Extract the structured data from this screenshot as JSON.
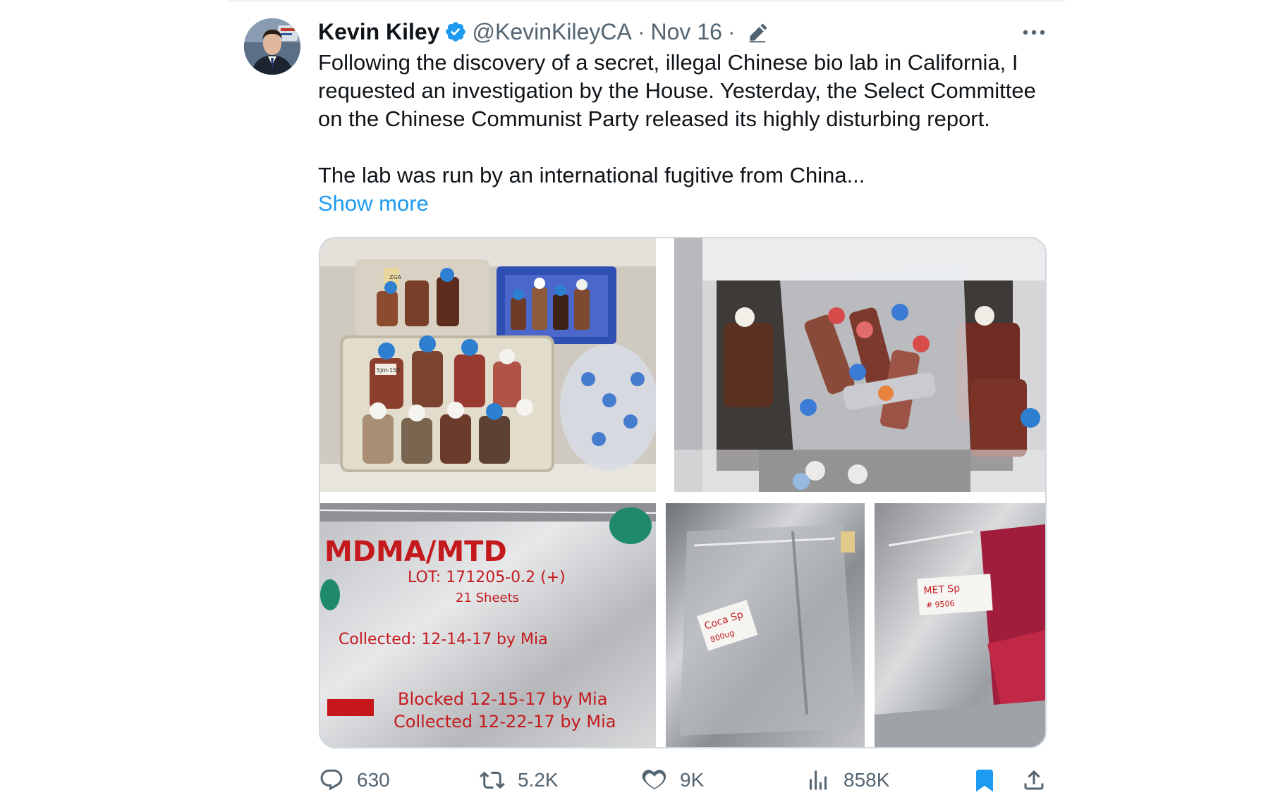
{
  "tweet": {
    "author": {
      "name": "Kevin Kiley",
      "handle": "@KevinKileyCA",
      "verified": true,
      "avatar": "profile-photo"
    },
    "separator": "·",
    "date": "Nov 16",
    "edited": true,
    "text_paragraph_1": "Following the discovery of a secret, illegal Chinese bio lab in California, I requested an investigation by the House. Yesterday, the Select Committee on the Chinese Communist Party released its highly disturbing report.",
    "text_paragraph_2": "The lab was run by an international fugitive from China...",
    "show_more": "Show more",
    "media": {
      "photo_1": {
        "label_1": "ZGA",
        "label_2": "5Jm-153"
      },
      "photo_3": {
        "line_1": "MDMA/MTD",
        "line_2": "LOT: 171205-0.2 (+)",
        "line_3": "21 Sheets",
        "line_4": "Collected: 12-14-17 by Mia",
        "line_5": "Blocked 12-15-17 by Mia",
        "line_6": "Collected 12-22-17 by Mia"
      },
      "photo_4": {
        "line_1": "Coca Sp",
        "line_2": "800ug"
      },
      "photo_5": {
        "line_1": "MET Sp",
        "line_2": "# 9506"
      }
    },
    "metrics": {
      "replies": "630",
      "retweets": "5.2K",
      "likes": "9K",
      "views": "858K"
    },
    "colors": {
      "accent": "#1d9bf0",
      "text": "#0f1419",
      "secondary": "#536471",
      "border": "#cfd9de"
    },
    "icons": {
      "verified": "verified-badge-icon",
      "edit": "pencil-edit-icon",
      "more": "more-dots-icon",
      "reply": "reply-bubble-icon",
      "retweet": "retweet-icon",
      "like": "heart-icon",
      "views": "analytics-bars-icon",
      "bookmark": "bookmark-filled-icon",
      "share": "share-upload-icon"
    }
  }
}
